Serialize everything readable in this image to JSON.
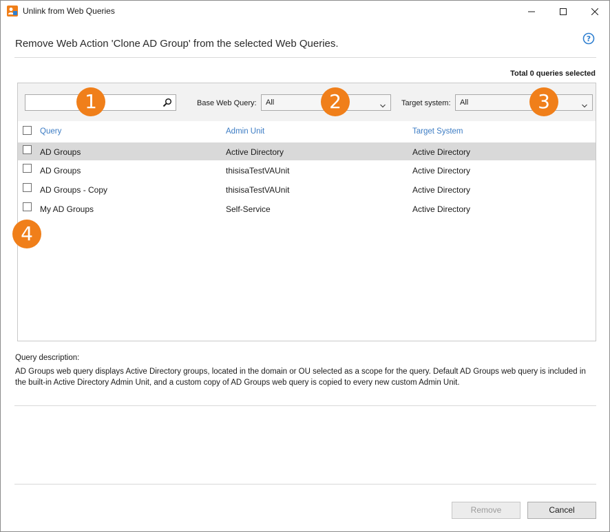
{
  "window": {
    "title": "Unlink from Web Queries",
    "controls": {
      "minimize": "minimize-icon",
      "maximize": "maximize-icon",
      "close": "close-icon"
    }
  },
  "header": {
    "heading": "Remove Web Action 'Clone AD Group' from the selected Web Queries.",
    "help_icon": "help-icon",
    "total_selected": "Total 0 queries selected"
  },
  "filters": {
    "search": {
      "value": "",
      "placeholder": ""
    },
    "base_web_query": {
      "label": "Base Web Query:",
      "value": "All"
    },
    "target_system": {
      "label": "Target system:",
      "value": "All"
    }
  },
  "callouts": [
    "1",
    "2",
    "3",
    "4"
  ],
  "table": {
    "columns": [
      "Query",
      "Admin Unit",
      "Target System"
    ],
    "rows": [
      {
        "query": "AD Groups",
        "admin_unit": "Active Directory",
        "target_system": "Active Directory",
        "selected": true
      },
      {
        "query": "AD Groups",
        "admin_unit": "thisisaTestVAUnit",
        "target_system": "Active Directory",
        "selected": false
      },
      {
        "query": "AD Groups - Copy",
        "admin_unit": "thisisaTestVAUnit",
        "target_system": "Active Directory",
        "selected": false
      },
      {
        "query": "My AD Groups",
        "admin_unit": "Self-Service",
        "target_system": "Active Directory",
        "selected": false
      }
    ]
  },
  "description": {
    "label": "Query description:",
    "text": "AD Groups web query displays Active Directory groups, located in the domain or OU selected as a scope for the query. Default AD Groups web query is included in the built-in Active Directory Admin Unit, and a custom copy of AD Groups web query is copied to every new custom Admin Unit."
  },
  "buttons": {
    "remove": "Remove",
    "cancel": "Cancel"
  },
  "colors": {
    "accent": "#f07f1a",
    "link": "#3c7cc4",
    "selected_row": "#d9d9d9"
  }
}
